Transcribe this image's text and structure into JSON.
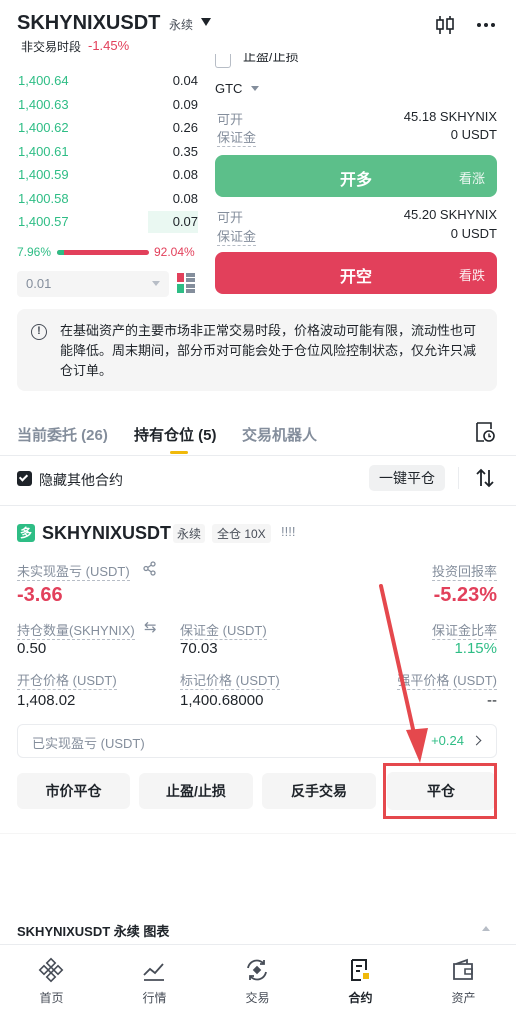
{
  "header": {
    "symbol": "SKHYNIXUSDT",
    "contract_type": "永续",
    "session_status": "非交易时段",
    "change": "-1.45%"
  },
  "orderbook": {
    "rows": [
      {
        "price": "1,400.64",
        "qty": "0.04"
      },
      {
        "price": "1,400.63",
        "qty": "0.09"
      },
      {
        "price": "1,400.62",
        "qty": "0.26"
      },
      {
        "price": "1,400.61",
        "qty": "0.35"
      },
      {
        "price": "1,400.59",
        "qty": "0.08"
      },
      {
        "price": "1,400.58",
        "qty": "0.08"
      },
      {
        "price": "1,400.57",
        "qty": "0.07"
      }
    ],
    "buy_ratio": "7.96%",
    "sell_ratio": "92.04%",
    "buy_fraction": 0.0796,
    "precision": "0.01"
  },
  "form": {
    "tpsl_label": "止盈/止损",
    "tif": "GTC",
    "long": {
      "available_label": "可开",
      "available": "45.18 SKHYNIX",
      "margin_label": "保证金",
      "margin": "0 USDT",
      "button": "开多",
      "sub": "看涨"
    },
    "short": {
      "available_label": "可开",
      "available": "45.20 SKHYNIX",
      "margin_label": "保证金",
      "margin": "0 USDT",
      "button": "开空",
      "sub": "看跌"
    }
  },
  "notice": "在基础资产的主要市场非正常交易时段，价格波动可能有限，流动性也可能降低。周末期间，部分币对可能会处于仓位风险控制状态，仅允许只减仓订单。",
  "tabs": {
    "open_orders": "当前委托 (26)",
    "positions": "持有仓位 (5)",
    "bots": "交易机器人"
  },
  "filter": {
    "hide_other": "隐藏其他合约",
    "close_all": "一键平仓"
  },
  "position": {
    "badge": "多",
    "symbol": "SKHYNIXUSDT",
    "type": "永续",
    "margin_mode": "全仓 10X",
    "signal": "!!!!",
    "upnl_label": "未实现盈亏 (USDT)",
    "upnl": "-3.66",
    "roe_label": "投资回报率",
    "roe": "-5.23%",
    "size_label": "持仓数量(SKHYNIX)",
    "size": "0.50",
    "margin_label": "保证金 (USDT)",
    "margin": "70.03",
    "margin_ratio_label": "保证金比率",
    "margin_ratio": "1.15%",
    "entry_label": "开仓价格 (USDT)",
    "entry": "1,408.02",
    "mark_label": "标记价格 (USDT)",
    "mark": "1,400.68000",
    "liq_label": "强平价格 (USDT)",
    "liq": "--",
    "rpnl_label": "已实现盈亏 (USDT)",
    "rpnl": "+0.24"
  },
  "actions": {
    "market_close": "市价平仓",
    "tpsl": "止盈/止损",
    "reverse": "反手交易",
    "close": "平仓"
  },
  "chart_bar": {
    "title": "SKHYNIXUSDT 永续 图表"
  },
  "bottom_nav": [
    {
      "label": "首页",
      "icon": "home-icon"
    },
    {
      "label": "行情",
      "icon": "markets-icon"
    },
    {
      "label": "交易",
      "icon": "trade-icon"
    },
    {
      "label": "合约",
      "icon": "futures-icon"
    },
    {
      "label": "资产",
      "icon": "wallet-icon"
    }
  ],
  "colors": {
    "up": "#2ebd85",
    "down": "#e2405b",
    "annotation": "#e5484d"
  }
}
